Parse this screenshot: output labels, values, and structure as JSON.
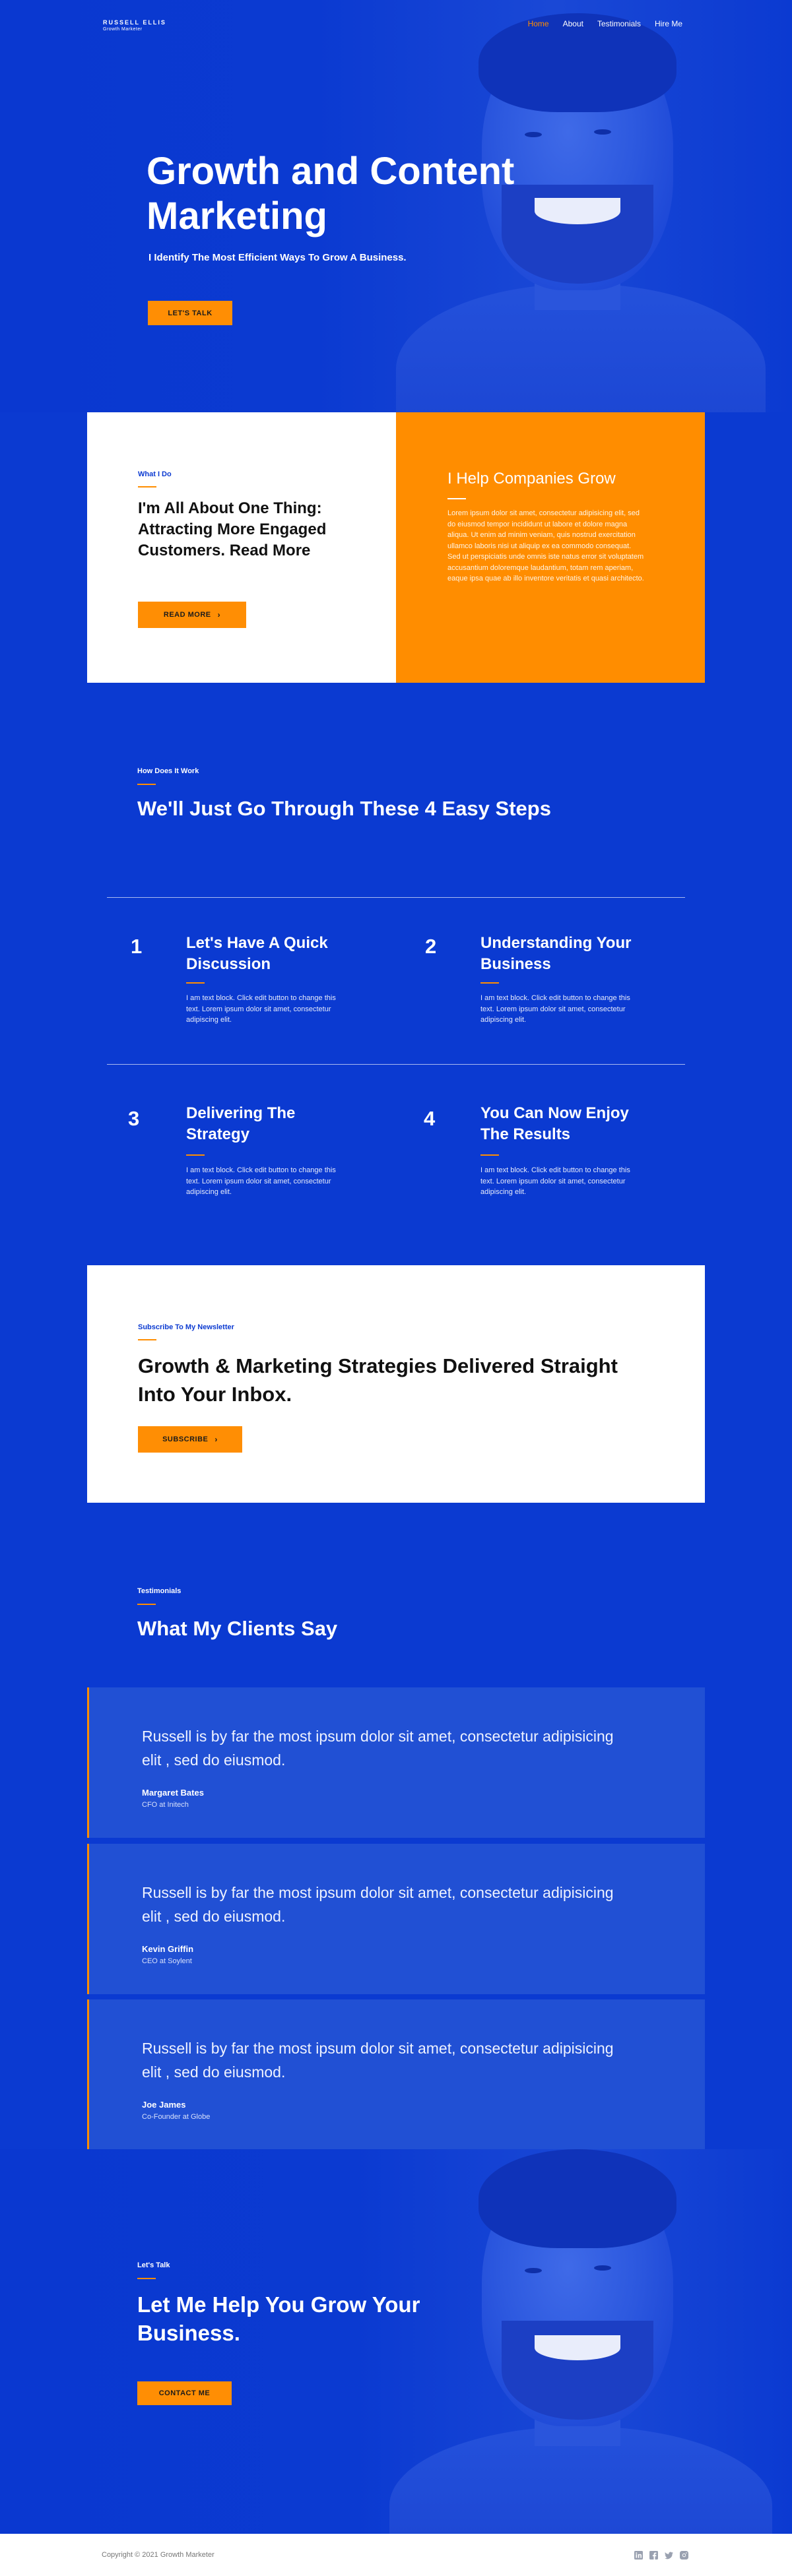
{
  "nav": {
    "logo_name": "RUSSELL ELLIS",
    "logo_tagline": "Growth Marketer",
    "links": [
      {
        "label": "Home",
        "active": true
      },
      {
        "label": "About",
        "active": false
      },
      {
        "label": "Testimonials",
        "active": false
      },
      {
        "label": "Hire Me",
        "active": false
      }
    ]
  },
  "hero": {
    "title": "Growth and Content Marketing",
    "subtitle": "I Identify The Most Efficient Ways To Grow A Business.",
    "cta_label": "LET'S TALK"
  },
  "what_i_do": {
    "eyebrow": "What I Do",
    "title": "I'm All About One Thing: Attracting More Engaged Customers. Read More",
    "button_label": "READ MORE",
    "panel_title": "I Help Companies Grow",
    "panel_text": "Lorem ipsum dolor sit amet, consectetur adipisicing elit, sed do eiusmod tempor incididunt ut labore et dolore magna aliqua. Ut enim ad minim veniam, quis nostrud exercitation ullamco laboris nisi ut aliquip ex ea commodo consequat. Sed ut perspiciatis unde omnis iste natus error sit voluptatem accusantium doloremque laudantium, totam rem aperiam, eaque ipsa quae ab illo inventore veritatis et quasi architecto."
  },
  "steps": {
    "eyebrow": "How Does It Work",
    "title": "We'll Just Go Through These 4 Easy Steps",
    "items": [
      {
        "number": "1",
        "title": "Let's Have A Quick Discussion",
        "text": "I am text block. Click edit button to change this text. Lorem ipsum dolor sit amet, consectetur adipiscing elit."
      },
      {
        "number": "2",
        "title": "Understanding Your Business",
        "text": "I am text block. Click edit button to change this text. Lorem ipsum dolor sit amet, consectetur adipiscing elit."
      },
      {
        "number": "3",
        "title": "Delivering The Strategy",
        "text": "I am text block. Click edit button to change this text. Lorem ipsum dolor sit amet, consectetur adipiscing elit."
      },
      {
        "number": "4",
        "title": "You Can Now Enjoy The Results",
        "text": "I am text block. Click edit button to change this text. Lorem ipsum dolor sit amet, consectetur adipiscing elit."
      }
    ]
  },
  "newsletter": {
    "eyebrow": "Subscribe To My Newsletter",
    "title": "Growth & Marketing Strategies Delivered Straight Into Your Inbox.",
    "button_label": "SUBSCRIBE"
  },
  "testimonials": {
    "eyebrow": "Testimonials",
    "title": "What My Clients Say",
    "items": [
      {
        "quote": "Russell is by far the most ipsum dolor sit amet, consectetur adipisicing elit , sed do eiusmod.",
        "name": "Margaret Bates",
        "role": "CFO at Initech"
      },
      {
        "quote": "Russell is by far the most ipsum dolor sit amet, consectetur adipisicing elit , sed do eiusmod.",
        "name": "Kevin Griffin",
        "role": "CEO at Soylent"
      },
      {
        "quote": "Russell is by far the most ipsum dolor sit amet, consectetur adipisicing elit , sed do eiusmod.",
        "name": "Joe James",
        "role": "Co-Founder at Globe"
      }
    ]
  },
  "cta": {
    "eyebrow": "Let's Talk",
    "title": "Let Me Help You Grow Your Business.",
    "button_label": "CONTACT ME"
  },
  "footer": {
    "copyright": "Copyright © 2021 Growth Marketer",
    "socials": [
      "linkedin-icon",
      "facebook-icon",
      "twitter-icon",
      "instagram-icon"
    ]
  },
  "colors": {
    "primary_blue": "#0b3ad1",
    "accent_orange": "#ff8d00",
    "card_blue": "#2150d4",
    "white": "#ffffff"
  }
}
